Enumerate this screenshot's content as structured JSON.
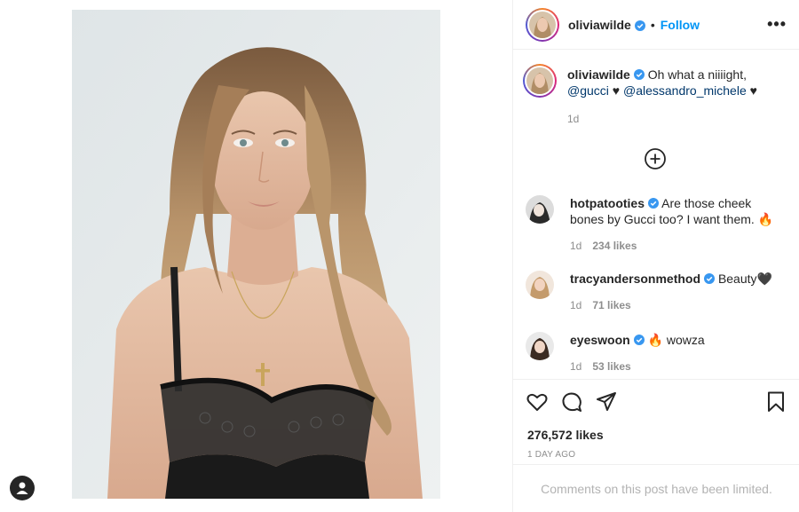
{
  "post": {
    "author": "oliviawilde",
    "follow_label": "Follow",
    "separator": "•",
    "more_label": "•••"
  },
  "caption": {
    "username": "oliviawilde",
    "text_start": "Oh what a niiiight, ",
    "mention1": "@gucci",
    "heart1": " ♥ ",
    "mention2": "@alessandro_michele",
    "heart2": " ♥",
    "time": "1d"
  },
  "comments": [
    {
      "username": "hotpatooties",
      "text": "Are those cheek bones by Gucci too? I want them. 🔥",
      "time": "1d",
      "likes": "234 likes"
    },
    {
      "username": "tracyandersonmethod",
      "text": "Beauty🖤",
      "time": "1d",
      "likes": "71 likes"
    },
    {
      "username": "eyeswoon",
      "text": "🔥 wowza",
      "time": "1d",
      "likes": "53 likes"
    }
  ],
  "engagement": {
    "likes": "276,572 likes",
    "time_ago": "1 DAY AGO",
    "comments_limited": "Comments on this post have been limited."
  },
  "icons": {
    "like": "heart-outline-icon",
    "comment": "comment-icon",
    "share": "paper-plane-icon",
    "save": "bookmark-icon",
    "load_more": "plus-circle-icon",
    "verified": "verified-badge-icon",
    "account": "account-icon"
  },
  "colors": {
    "link": "#00376b",
    "follow": "#0095f6",
    "verified": "#3897f0",
    "muted": "#8e8e8e"
  }
}
